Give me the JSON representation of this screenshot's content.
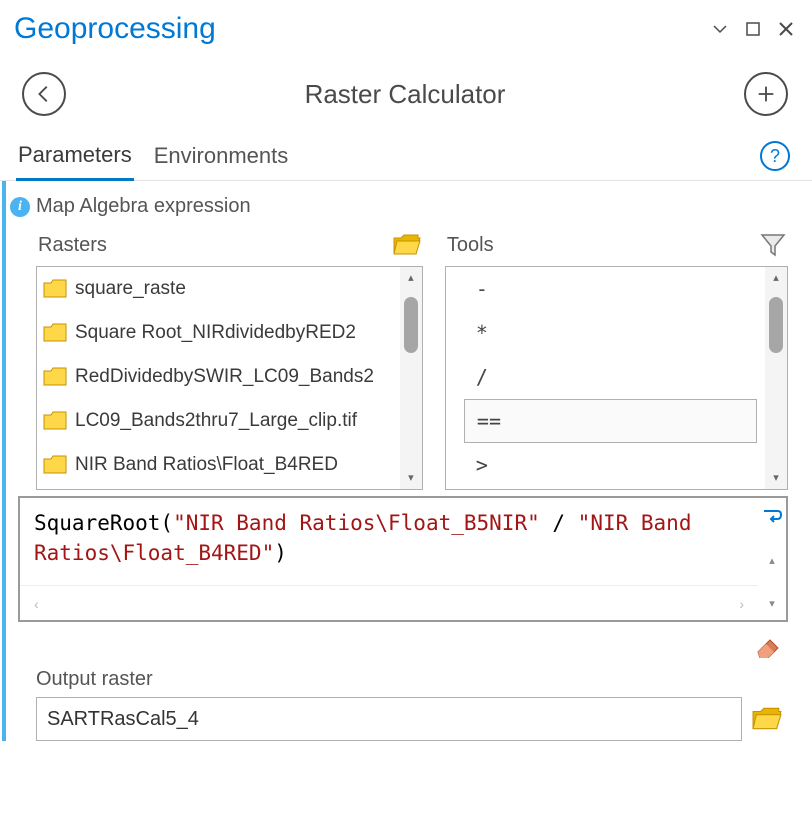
{
  "window": {
    "title": "Geoprocessing"
  },
  "toolbar": {
    "tool_title": "Raster Calculator"
  },
  "tabs": {
    "parameters": "Parameters",
    "environments": "Environments",
    "active": "parameters"
  },
  "section": {
    "label": "Map Algebra expression",
    "rasters_label": "Rasters",
    "tools_label": "Tools"
  },
  "rasters": [
    "square_raste",
    "Square Root_NIRdividedbyRED2",
    "RedDividedbySWIR_LC09_Bands2",
    "LC09_Bands2thru7_Large_clip.tif",
    "NIR Band Ratios\\Float_B4RED"
  ],
  "tools": [
    {
      "label": "-",
      "selected": false
    },
    {
      "label": "*",
      "selected": false
    },
    {
      "label": "/",
      "selected": false
    },
    {
      "label": "==",
      "selected": true
    },
    {
      "label": ">",
      "selected": false
    }
  ],
  "expression": {
    "fn_open": "SquareRoot(",
    "str1": "\"NIR Band Ratios\\Float_B5NIR\"",
    "op": " / ",
    "str2": "\"NIR Band Ratios\\Float_B4RED\"",
    "fn_close": ")"
  },
  "output": {
    "label": "Output raster",
    "value": "SARTRasCal5_4"
  },
  "icons": {
    "chevron_dd": "⌄"
  }
}
